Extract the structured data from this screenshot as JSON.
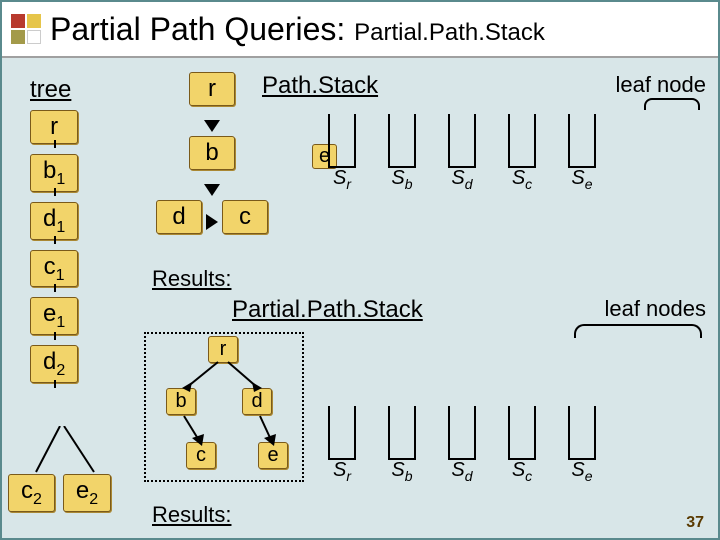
{
  "title_main": "Partial Path Queries: ",
  "title_sub": "Partial.Path.Stack",
  "left_tree_label": "tree",
  "left_tree_nodes": [
    "r",
    "b",
    "d",
    "c",
    "e",
    "d"
  ],
  "left_tree_bottom": [
    "c",
    "e"
  ],
  "pathstack_label": "Path.Stack",
  "leaf_node_label": "leaf node",
  "chain": {
    "r": "r",
    "b": "b",
    "d": "d",
    "c": "c",
    "e": "e"
  },
  "stack_labels": [
    "S",
    "S",
    "S",
    "S",
    "S"
  ],
  "stack_subs": [
    "r",
    "b",
    "d",
    "c",
    "e"
  ],
  "results_label": "Results:",
  "partial_label": "Partial.Path.Stack",
  "leaf_nodes_label": "leaf nodes",
  "pp_tree": {
    "r": "r",
    "b": "b",
    "d": "d",
    "c": "c",
    "e": "e"
  },
  "page_num": "37"
}
